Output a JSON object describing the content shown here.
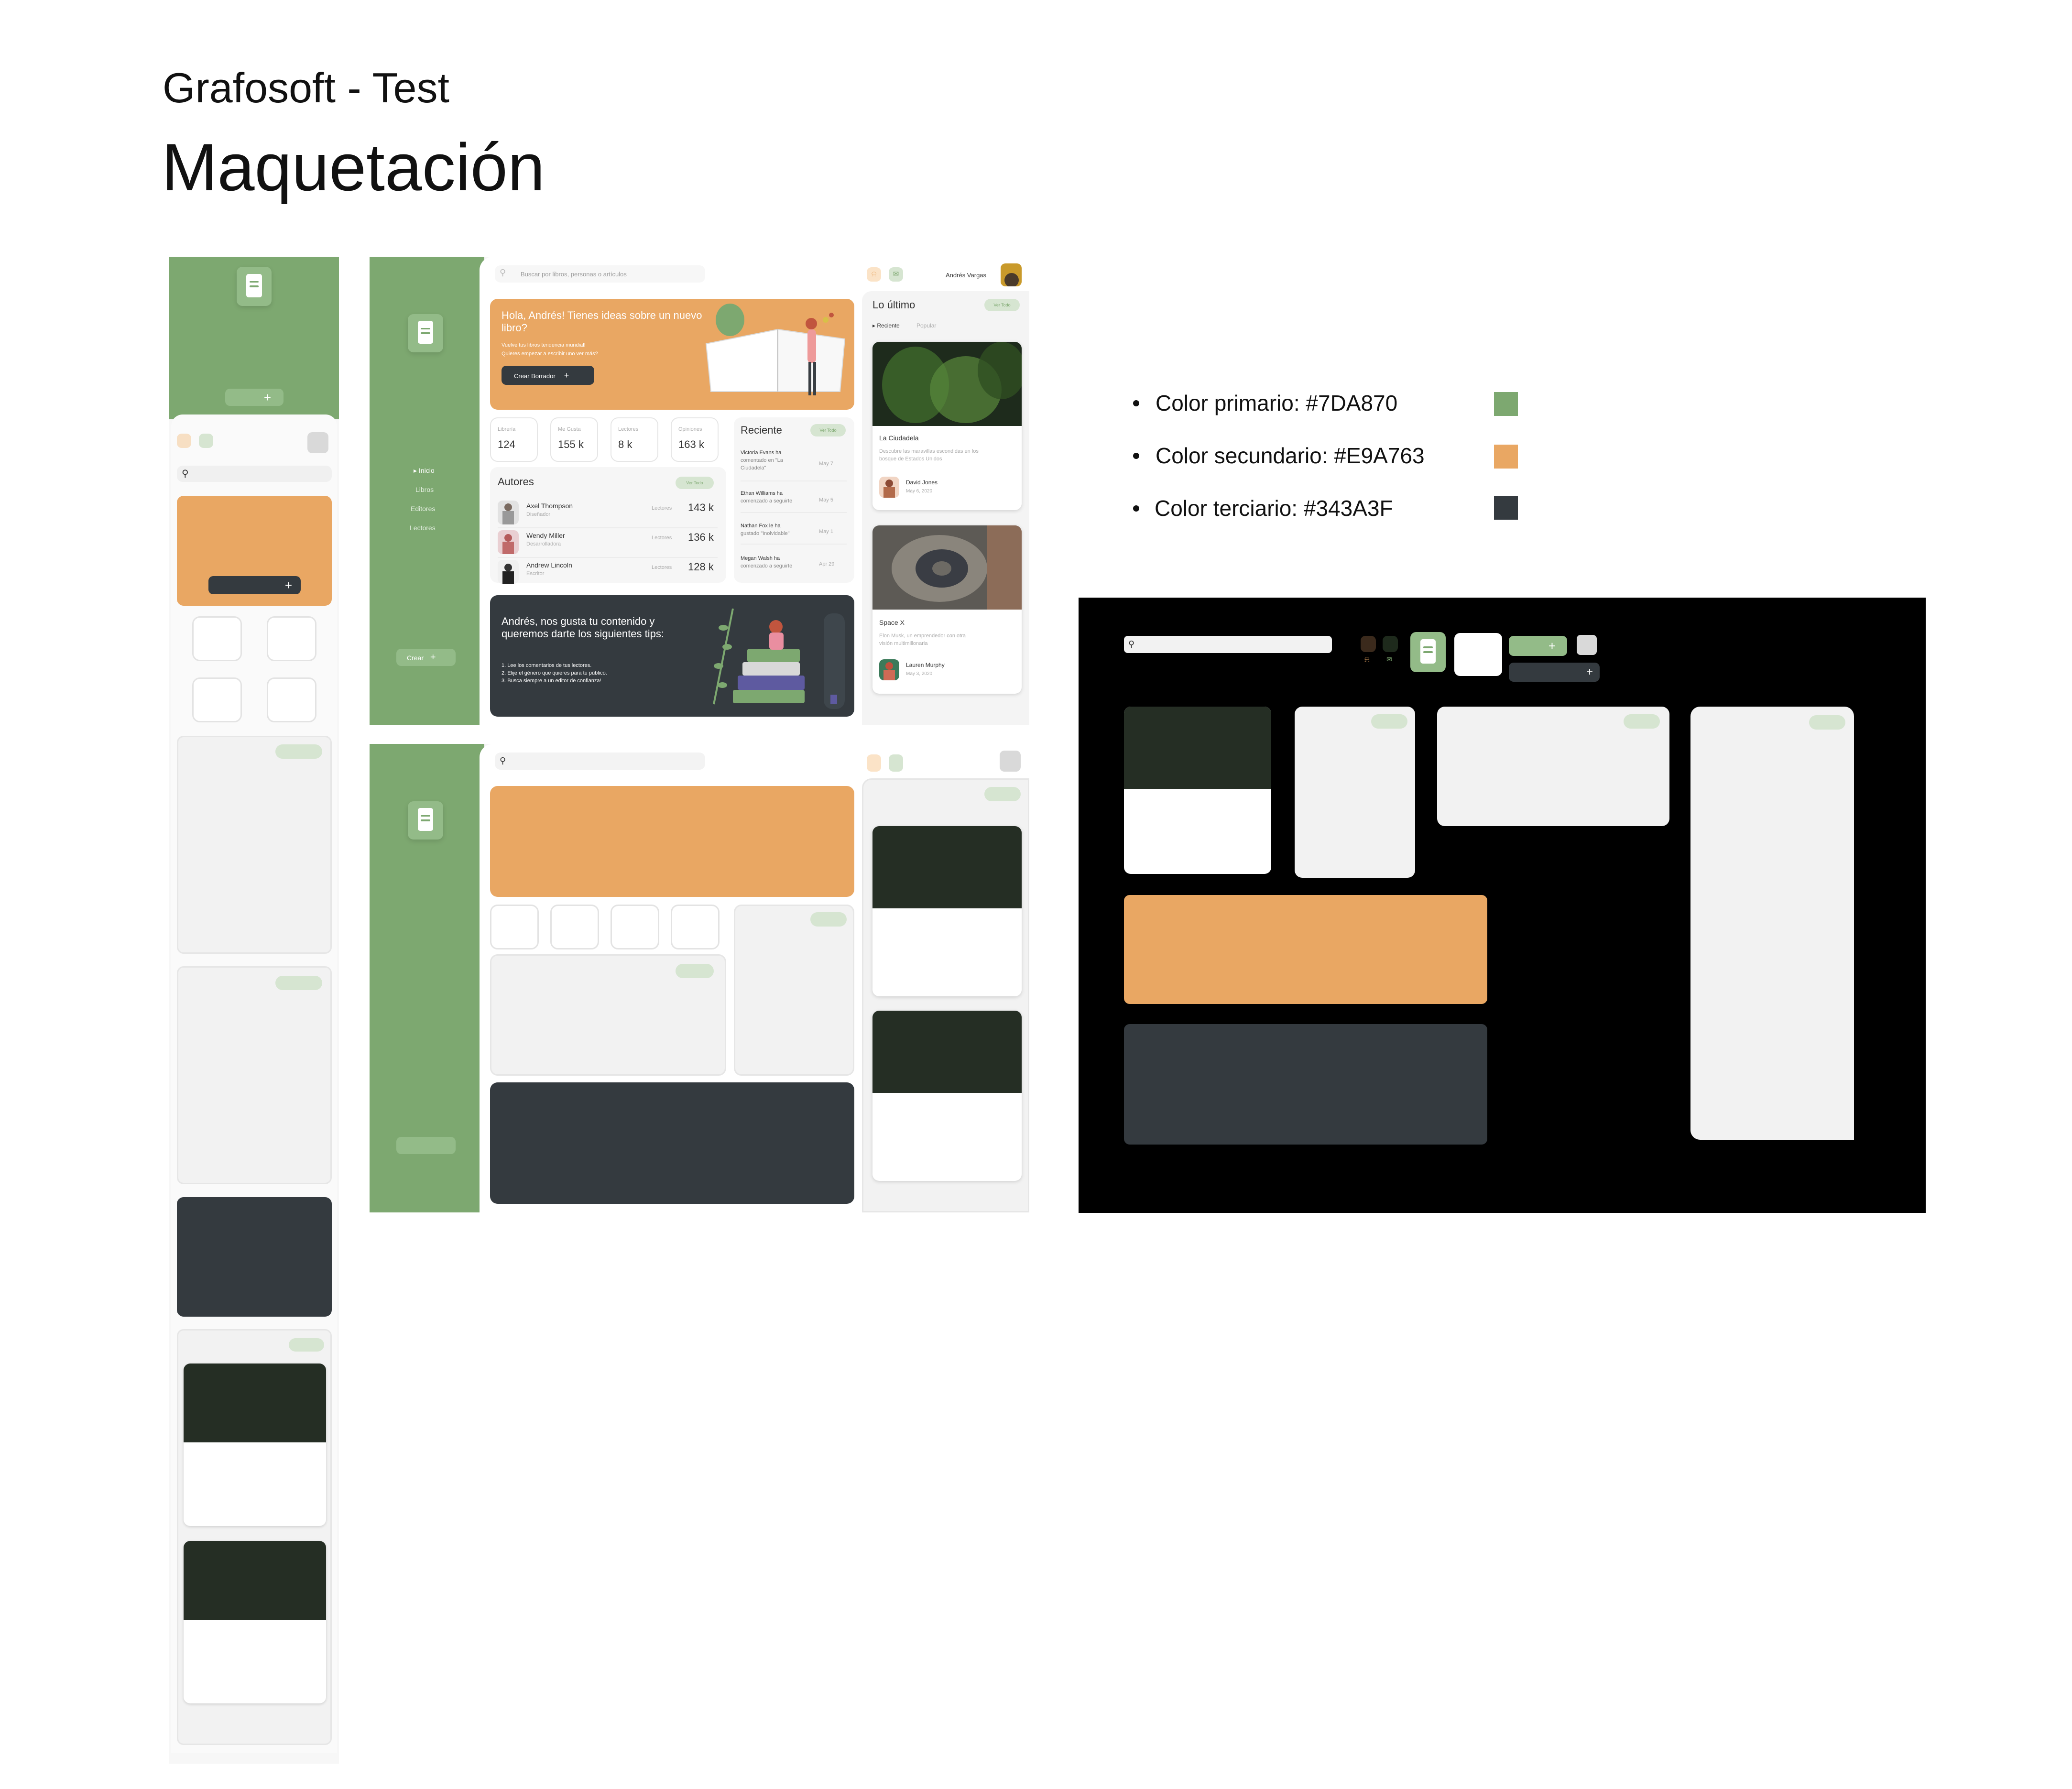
{
  "header": {
    "project_title": "Grafosoft - Test",
    "page_title": "Maquetación"
  },
  "colors": {
    "primary": "#7DA870",
    "secondary": "#E9A763",
    "tertiary": "#343A3F",
    "dark_green": "#252E24",
    "light_gray": "#F2F2F2"
  },
  "palette": [
    {
      "label": "Color primario: #7DA870",
      "hex": "#7DA870"
    },
    {
      "label": "Color secundario: #E9A763",
      "hex": "#E9A763"
    },
    {
      "label": "Color terciario: #343A3F",
      "hex": "#343A3F"
    }
  ],
  "desktop": {
    "search": {
      "placeholder": "Buscar por libros, personas o artículos"
    },
    "user_name": "Andrés Vargas",
    "sidebar": {
      "nav": [
        {
          "label": "Inicio",
          "active": true
        },
        {
          "label": "Libros",
          "active": false
        },
        {
          "label": "Editores",
          "active": false
        },
        {
          "label": "Lectores",
          "active": false
        }
      ],
      "create_label": "Crear",
      "create_icon": "plus-icon"
    },
    "hero": {
      "title": "Hola, Andrés! Tienes ideas sobre un nuevo libro?",
      "subtitle_1": "Vuelve tus libros tendencia mundial!",
      "subtitle_2": "Quieres empezar a escribir uno ver más?",
      "button": "Crear Borrador"
    },
    "stats": [
      {
        "label": "Librería",
        "value": "124"
      },
      {
        "label": "Me Gusta",
        "value": "155 k"
      },
      {
        "label": "Lectores",
        "value": "8 k"
      },
      {
        "label": "Opiniones",
        "value": "163 k"
      }
    ],
    "authors": {
      "title": "Autores",
      "see_all": "Ver Todo",
      "items": [
        {
          "name": "Axel Thompson",
          "role": "Diseñador",
          "metric_label": "Lectores",
          "metric": "143 k"
        },
        {
          "name": "Wendy Miller",
          "role": "Desarrolladora",
          "metric_label": "Lectores",
          "metric": "136 k"
        },
        {
          "name": "Andrew Lincoln",
          "role": "Escritor",
          "metric_label": "Lectores",
          "metric": "128 k"
        }
      ]
    },
    "recent": {
      "title": "Reciente",
      "see_all": "Ver Todo",
      "items": [
        {
          "line1": "Victoria Evans ha",
          "line2": "comentado en \"La",
          "line3": "Ciudadela\"",
          "date": "May 7"
        },
        {
          "line1": "Ethan Williams ha",
          "line2": "comenzado a seguirte",
          "line3": "",
          "date": "May 5"
        },
        {
          "line1": "Nathan Fox le ha",
          "line2": "gustado \"Inolvidable\"",
          "line3": "",
          "date": "May 1"
        },
        {
          "line1": "Megan Walsh ha",
          "line2": "comenzado a seguirte",
          "line3": "",
          "date": "Apr 29"
        }
      ]
    },
    "tips": {
      "title": "Andrés, nos gusta tu contenido y queremos darte los siguientes tips:",
      "items": [
        "1. Lee los comentarios de tus lectores.",
        "2. Elije el género que quieres para tu público.",
        "3. Busca siempre a un editor de confianza!"
      ]
    },
    "latest": {
      "title": "Lo último",
      "see_all": "Ver Todo",
      "tabs": [
        "Reciente",
        "Popular"
      ],
      "cards": [
        {
          "title": "La Ciudadela",
          "desc_1": "Descubre las maravillas escondidas en los",
          "desc_2": "bosque de Estados Unidos",
          "author": "David Jones",
          "date": "May 6, 2020"
        },
        {
          "title": "Space X",
          "desc_1": "Elon Musk, un emprendedor con otra",
          "desc_2": "visión multimillonaria",
          "author": "Lauren Murphy",
          "date": "May 3, 2020"
        }
      ]
    }
  }
}
